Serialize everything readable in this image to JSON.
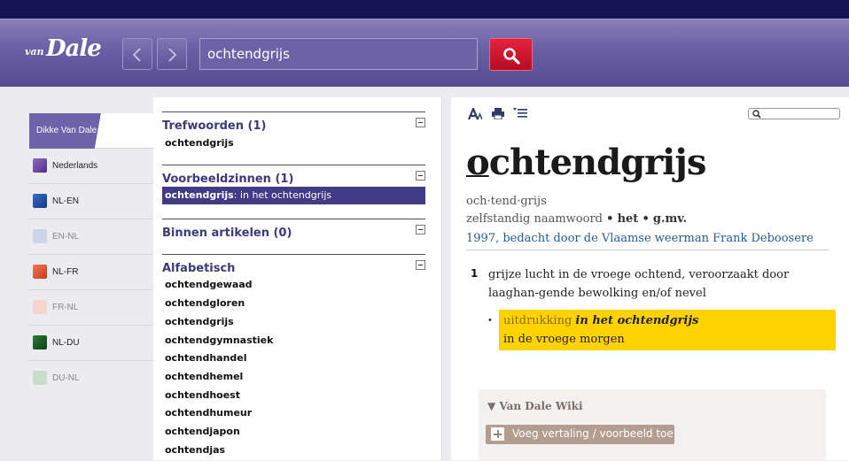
{
  "header": {
    "logo_small": "van",
    "logo_big": "Dale",
    "search_value": "ochtendgrijs"
  },
  "sidebar": {
    "items": [
      {
        "label": "Dikke Van Dale",
        "color": "#6e62a8",
        "active": true
      },
      {
        "label": "Nederlands",
        "color": "#6b4aa0"
      },
      {
        "label": "NL-EN",
        "color": "#1f4aa0"
      },
      {
        "label": "EN-NL",
        "color": "#c9d5e8",
        "dim": true
      },
      {
        "label": "NL-FR",
        "color": "#e05a3a"
      },
      {
        "label": "FR-NL",
        "color": "#f2d3cc",
        "dim": true
      },
      {
        "label": "NL-DU",
        "color": "#145a20"
      },
      {
        "label": "DU-NL",
        "color": "#c8dcc8",
        "dim": true
      }
    ]
  },
  "results": {
    "trefwoorden_title": "Trefwoorden (1)",
    "trefwoord": "ochtendgrijs",
    "voorbeeldzinnen_title": "Voorbeeldzinnen (1)",
    "voorbeeld_bold": "ochtendgrijs",
    "voorbeeld_rest": ": in het ochtendgrijs",
    "binnen_title": "Binnen artikelen (0)",
    "alfabetisch_title": "Alfabetisch",
    "alfabetisch": [
      "ochtendgewaad",
      "ochtendgloren",
      "ochtendgrijs",
      "ochtendgymnastiek",
      "ochtendhandel",
      "ochtendhemel",
      "ochtendhoest",
      "ochtendhumeur",
      "ochtendjapon",
      "ochtendjas"
    ]
  },
  "article": {
    "headword_first": "o",
    "headword_rest": "chtendgrijs",
    "syllables": "och·tend·grijs",
    "pos": "zelfstandig naamwoord",
    "dot": "•",
    "article_word": "het",
    "number": "g.mv.",
    "etymology": "1997, bedacht door de Vlaamse weerman Frank Deboosere",
    "sense_number": "1",
    "sense_text": "grijze lucht in de vroege ochtend, veroorzaakt door laaghan-gende bewolking en/of nevel",
    "bullet": "•",
    "expr_label": "uitdrukking",
    "expr_text": "in het ochtendgrijs",
    "expr_meaning": "in de vroege morgen"
  },
  "wiki": {
    "title": "▼ Van Dale Wiki",
    "button": "Voeg vertaling / voorbeeld toe"
  }
}
